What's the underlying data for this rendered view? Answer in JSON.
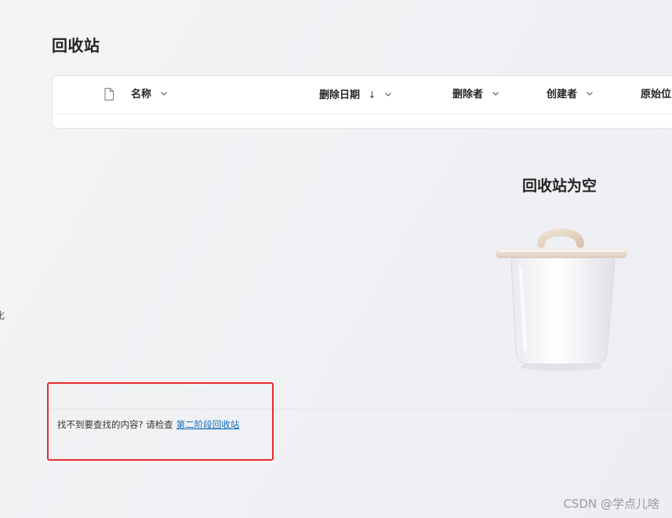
{
  "page": {
    "title": "回收站"
  },
  "table": {
    "columns": [
      {
        "label": "名称",
        "icon": "chevron-down-icon"
      },
      {
        "label": "删除日期",
        "sort_indicator": "↓",
        "icon": "chevron-down-icon"
      },
      {
        "label": "删除者",
        "icon": "chevron-down-icon"
      },
      {
        "label": "创建者",
        "icon": "chevron-down-icon"
      },
      {
        "label": "原始位"
      }
    ],
    "file_type_icon": "file-icon"
  },
  "empty_state": {
    "title": "回收站为空",
    "illustration": "recycle-bin-icon"
  },
  "left_edge_text": "化",
  "footer": {
    "text": "找不到要查找的内容? 请检查",
    "link_label": "第二阶段回收站"
  },
  "watermark": "CSDN @学点儿啥",
  "colors": {
    "link": "#0f6cbd",
    "highlight": "#e52b2b",
    "text": "#242424"
  }
}
